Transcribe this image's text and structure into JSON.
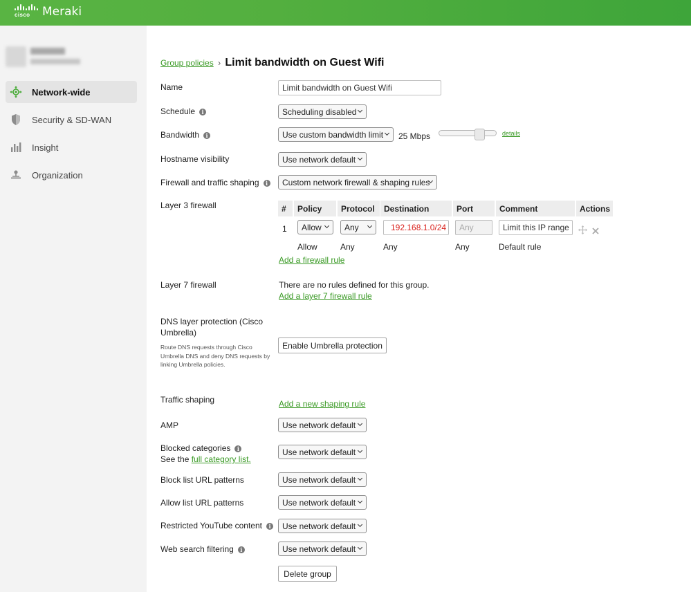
{
  "header": {
    "brand_small": "cisco",
    "brand": "Meraki"
  },
  "sidebar": {
    "items": [
      {
        "label": "Network-wide",
        "icon": "network-wide-icon"
      },
      {
        "label": "Security & SD-WAN",
        "icon": "shield-icon"
      },
      {
        "label": "Insight",
        "icon": "bar-chart-icon"
      },
      {
        "label": "Organization",
        "icon": "organization-icon"
      }
    ]
  },
  "breadcrumb": {
    "parent": "Group policies",
    "separator": "›",
    "title": "Limit bandwidth on Guest Wifi"
  },
  "form": {
    "name": {
      "label": "Name",
      "value": "Limit bandwidth on Guest Wifi"
    },
    "schedule": {
      "label": "Schedule",
      "value": "Scheduling disabled"
    },
    "bandwidth": {
      "label": "Bandwidth",
      "value": "Use custom bandwidth limit",
      "rate": "25 Mbps",
      "details": "details",
      "slider_level": 0.75
    },
    "hostname": {
      "label": "Hostname visibility",
      "value": "Use network default"
    },
    "firewall_shaping": {
      "label": "Firewall and traffic shaping",
      "value": "Custom network firewall & shaping rules"
    },
    "layer3": {
      "label": "Layer 3 firewall",
      "columns": [
        "#",
        "Policy",
        "Protocol",
        "Destination",
        "Port",
        "Comment",
        "Actions"
      ],
      "rule": {
        "num": "1",
        "policy": "Allow",
        "protocol": "Any",
        "destination": "192.168.1.0/24",
        "port_placeholder": "Any",
        "comment": "Limit this IP range"
      },
      "default_rule": {
        "policy": "Allow",
        "protocol": "Any",
        "destination": "Any",
        "port": "Any",
        "comment": "Default rule"
      },
      "add_link": "Add a firewall rule"
    },
    "layer7": {
      "label": "Layer 7 firewall",
      "empty_text": "There are no rules defined for this group.",
      "add_link": "Add a layer 7 firewall rule"
    },
    "dns": {
      "label": "DNS layer protection (Cisco Umbrella)",
      "help": "Route DNS requests through Cisco Umbrella DNS and deny DNS requests by linking Umbrella policies.",
      "button": "Enable Umbrella protection"
    },
    "traffic_shaping": {
      "label": "Traffic shaping",
      "add_link": "Add a new shaping rule"
    },
    "amp": {
      "label": "AMP",
      "value": "Use network default"
    },
    "blocked_categories": {
      "label": "Blocked categories",
      "see_prefix": "See the",
      "see_link": "full category list.",
      "value": "Use network default"
    },
    "block_list": {
      "label": "Block list URL patterns",
      "value": "Use network default"
    },
    "allow_list": {
      "label": "Allow list URL patterns",
      "value": "Use network default"
    },
    "youtube": {
      "label": "Restricted YouTube content",
      "value": "Use network default"
    },
    "web_search": {
      "label": "Web search filtering",
      "value": "Use network default"
    },
    "delete_button": "Delete group"
  },
  "colors": {
    "accent_green": "#3a9a25",
    "header_green": "#53af3f",
    "destination_text": "#d9201b"
  }
}
